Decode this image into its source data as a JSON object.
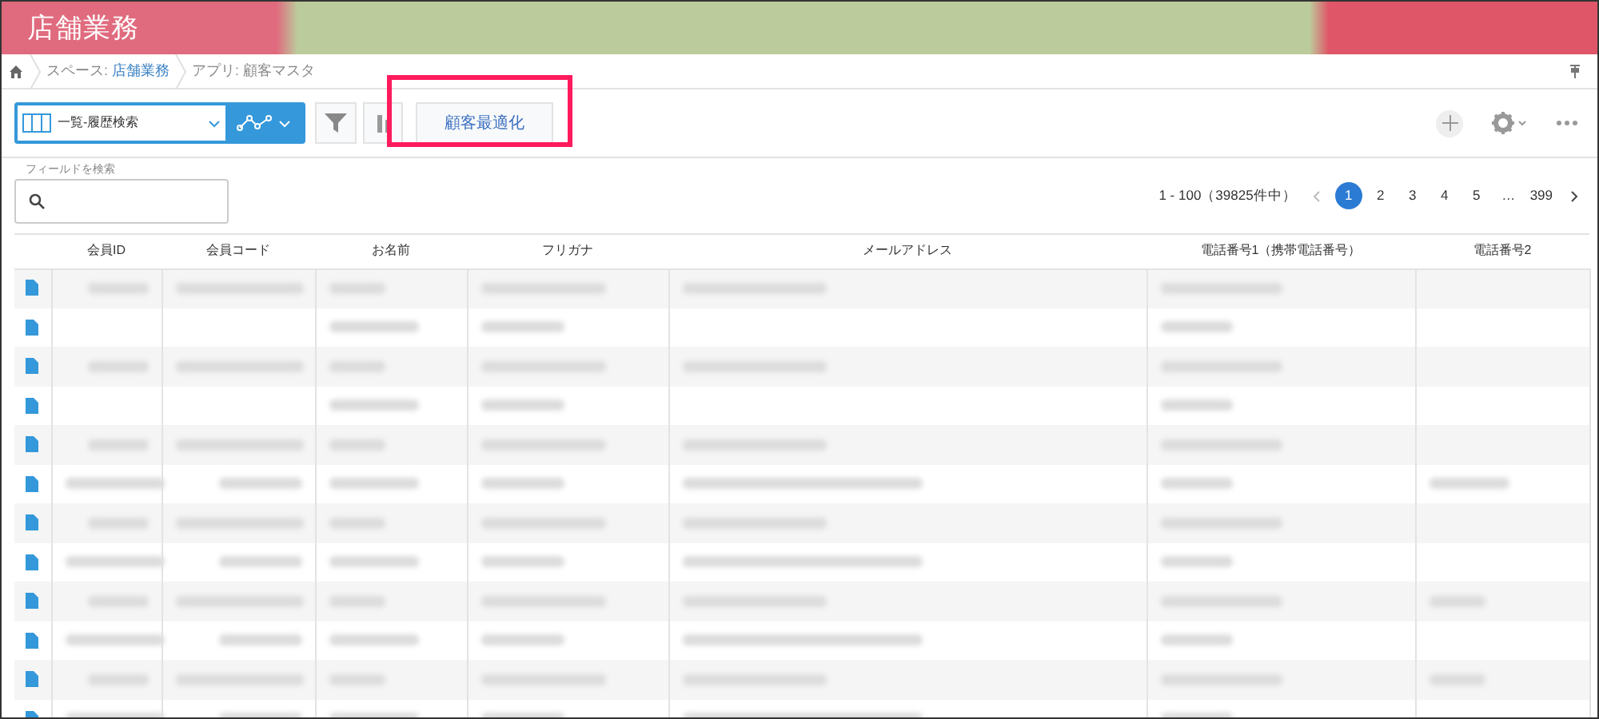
{
  "header": {
    "title": "店舗業務"
  },
  "breadcrumb": [
    {
      "label": "スペース: ",
      "link": "店舗業務"
    },
    {
      "label": "アプリ: 顧客マスタ"
    }
  ],
  "toolbar": {
    "view": "一覧-履歴検索",
    "custom_button": "顧客最適化",
    "highlighted": true
  },
  "field_search": {
    "label": "フィールドを検索"
  },
  "pagination": {
    "range": "1 - 100（39825件中）",
    "pages": [
      {
        "label": "1",
        "selected": true
      },
      {
        "label": "2",
        "selected": false
      },
      {
        "label": "3",
        "selected": false
      },
      {
        "label": "4",
        "selected": false
      },
      {
        "label": "5",
        "selected": false
      },
      {
        "label": "…",
        "selected": false
      },
      {
        "label": "399",
        "selected": false
      }
    ]
  },
  "table": {
    "columns": [
      "会員ID",
      "会員コード",
      "お名前",
      "フリガナ",
      "メールアドレス",
      "電話番号1（携帯電話番号）",
      "電話番号2"
    ],
    "rows": [
      {
        "redacted_cells": [
          true,
          true,
          true,
          true,
          true,
          true,
          false
        ]
      },
      {
        "redacted_cells": [
          false,
          false,
          true,
          true,
          false,
          true,
          false
        ]
      },
      {
        "redacted_cells": [
          true,
          true,
          true,
          true,
          true,
          true,
          false
        ]
      },
      {
        "redacted_cells": [
          false,
          false,
          true,
          true,
          false,
          true,
          false
        ]
      },
      {
        "redacted_cells": [
          true,
          true,
          true,
          true,
          true,
          true,
          false
        ]
      },
      {
        "redacted_cells": [
          true,
          true,
          true,
          true,
          true,
          true,
          true
        ]
      },
      {
        "redacted_cells": [
          true,
          true,
          true,
          true,
          true,
          true,
          false
        ]
      },
      {
        "redacted_cells": [
          true,
          true,
          true,
          true,
          true,
          true,
          false
        ]
      },
      {
        "redacted_cells": [
          true,
          true,
          true,
          true,
          true,
          true,
          true
        ]
      },
      {
        "redacted_cells": [
          true,
          true,
          true,
          true,
          true,
          true,
          false
        ]
      },
      {
        "redacted_cells": [
          true,
          true,
          true,
          true,
          true,
          true,
          true
        ]
      },
      {
        "redacted_cells": [
          true,
          true,
          true,
          true,
          true,
          true,
          false
        ]
      }
    ]
  }
}
